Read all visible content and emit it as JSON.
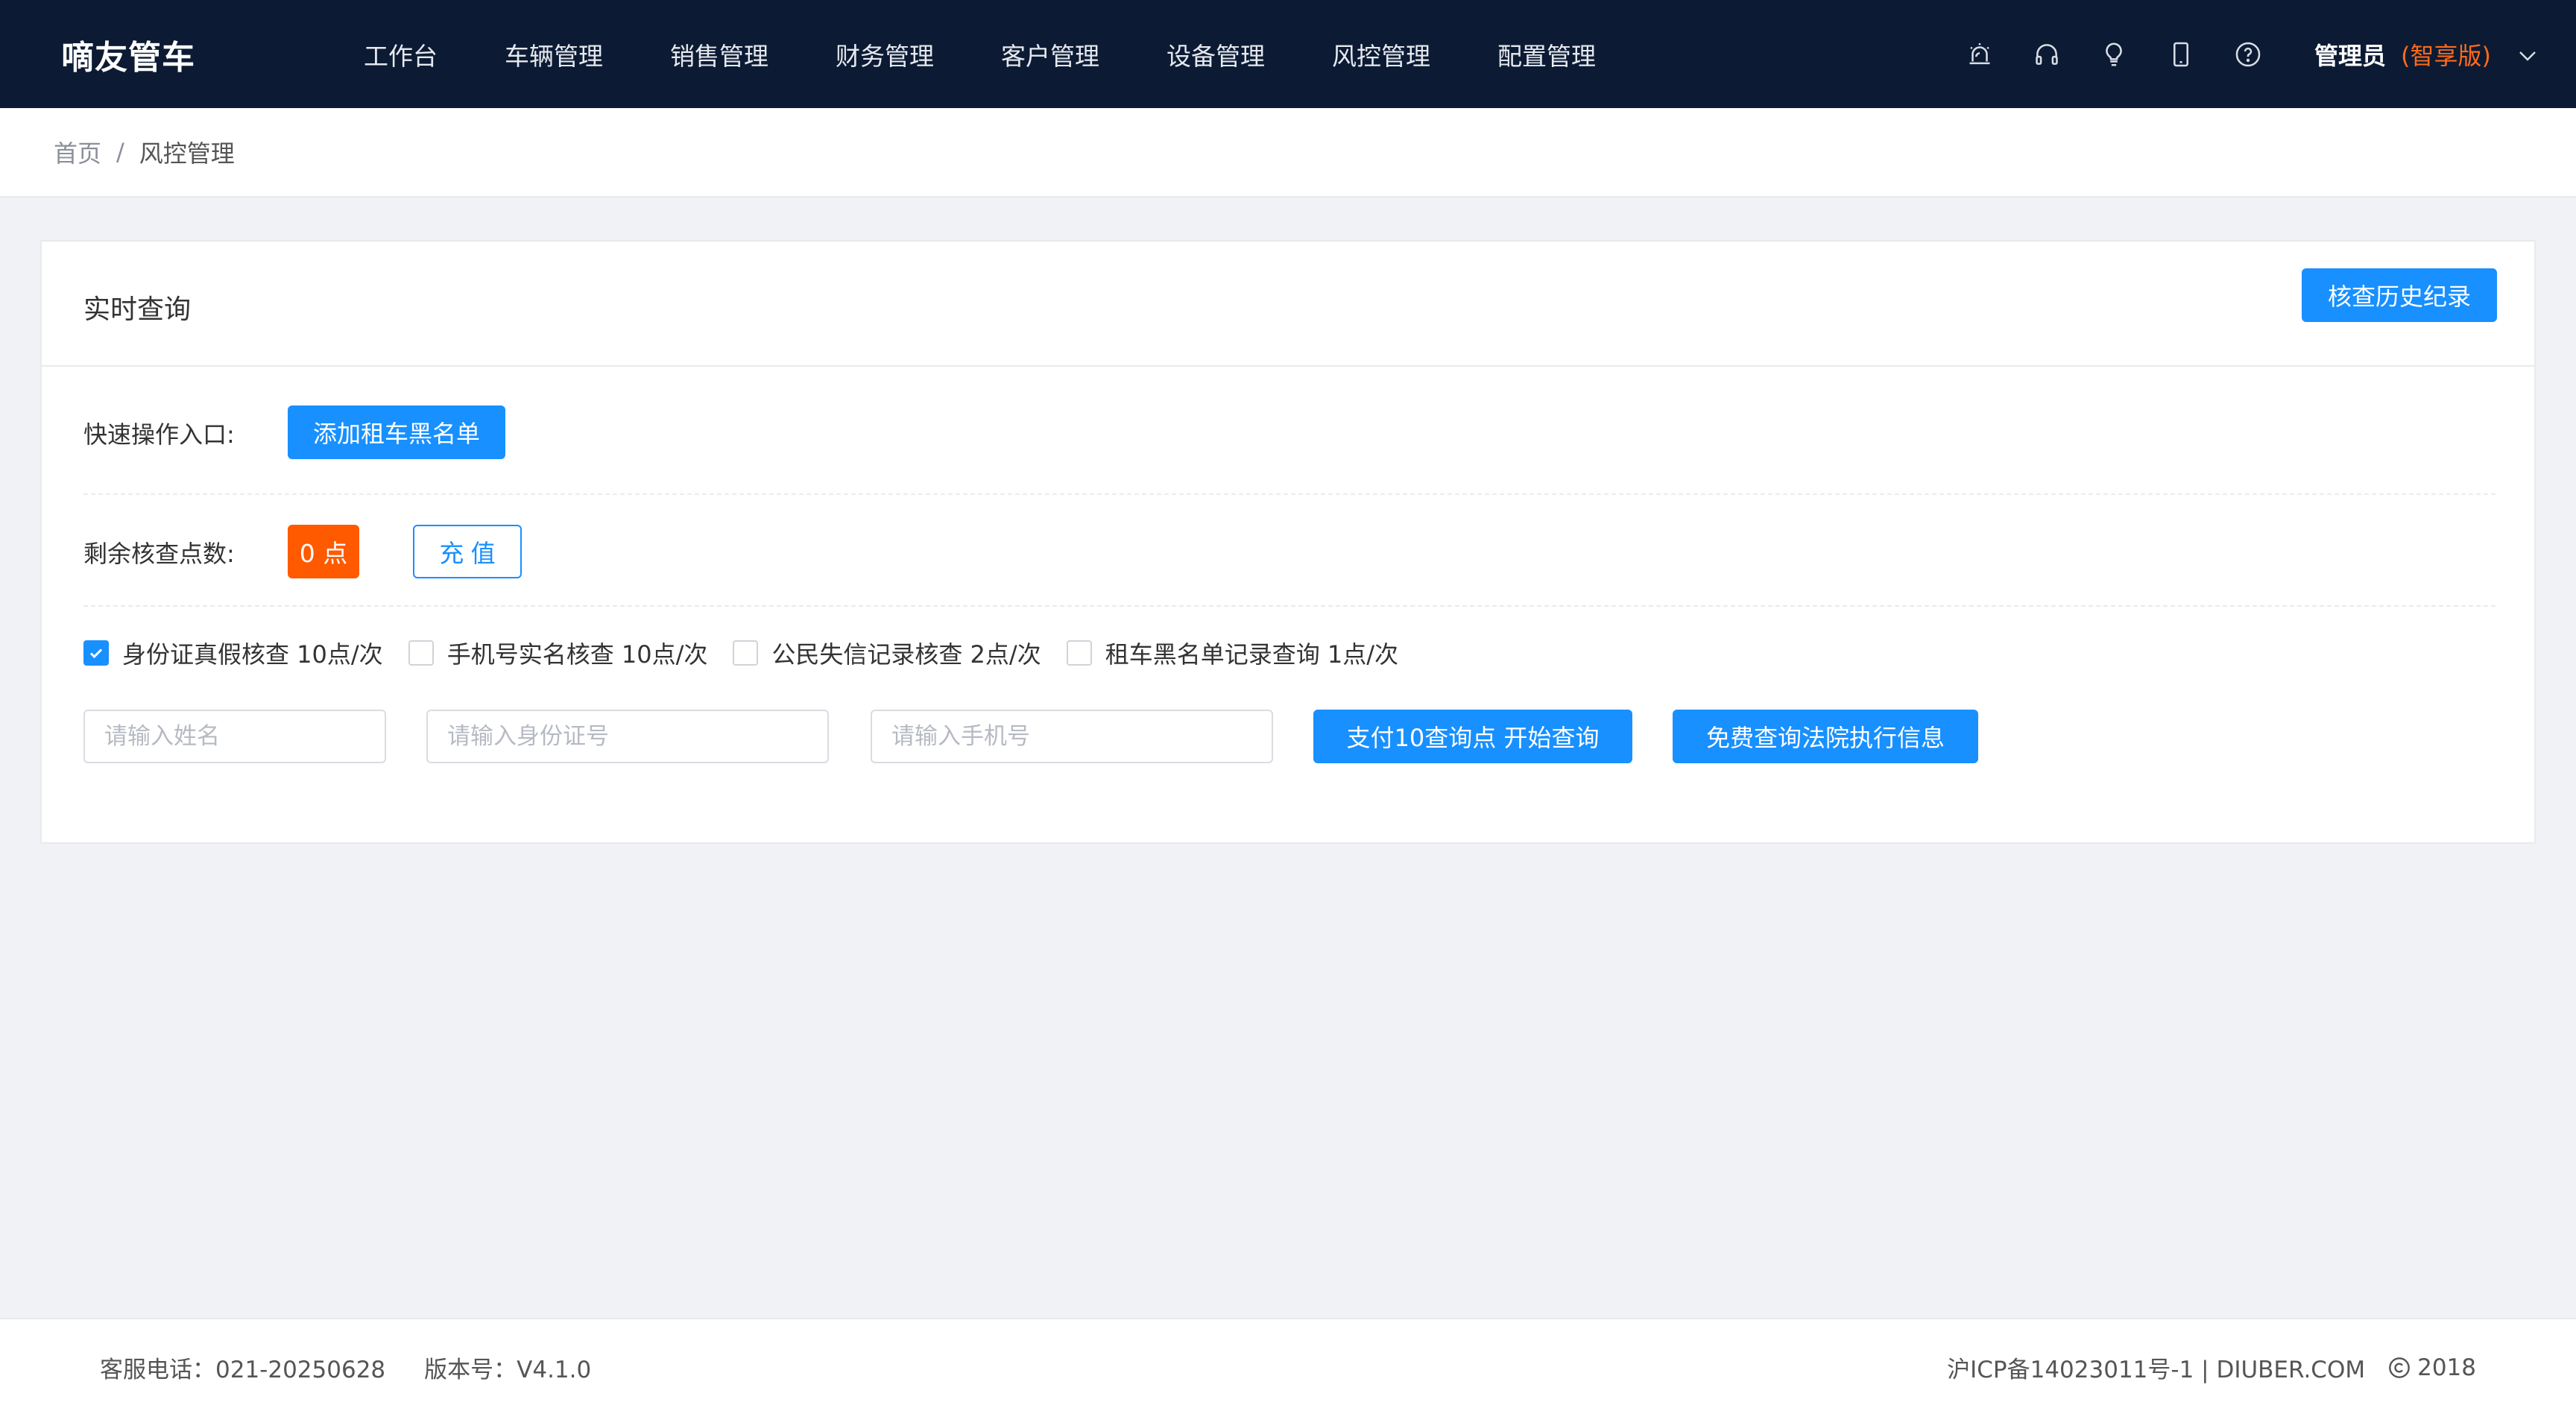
{
  "app": {
    "logo": "嘀友管车"
  },
  "nav": {
    "items": [
      {
        "label": "工作台"
      },
      {
        "label": "车辆管理"
      },
      {
        "label": "销售管理"
      },
      {
        "label": "财务管理"
      },
      {
        "label": "客户管理"
      },
      {
        "label": "设备管理"
      },
      {
        "label": "风控管理"
      },
      {
        "label": "配置管理"
      }
    ]
  },
  "toolbar": {
    "icons": [
      "alarm-icon",
      "headset-icon",
      "lightbulb-icon",
      "mobile-icon",
      "help-icon"
    ],
    "user_name": "管理员",
    "edition": "(智享版)"
  },
  "breadcrumb": {
    "home": "首页",
    "separator": "/",
    "current": "风控管理"
  },
  "card": {
    "title": "实时查询",
    "history_button": "核查历史纪录",
    "quick_label": "快速操作入口:",
    "add_blacklist_button": "添加租车黑名单",
    "points_label": "剩余核查点数:",
    "points_value": "0 点",
    "recharge_button": "充 值",
    "checks": [
      {
        "label": "身份证真假核查 10点/次",
        "checked": true
      },
      {
        "label": "手机号实名核查 10点/次",
        "checked": false
      },
      {
        "label": "公民失信记录核查 2点/次",
        "checked": false
      },
      {
        "label": "租车黑名单记录查询 1点/次",
        "checked": false
      }
    ],
    "name_placeholder": "请输入姓名",
    "id_placeholder": "请输入身份证号",
    "phone_placeholder": "请输入手机号",
    "pay_button": "支付10查询点 开始查询",
    "court_button": "免费查询法院执行信息"
  },
  "footer": {
    "service_phone": "客服电话：021-20250628",
    "version": "版本号：V4.1.0",
    "icp": "沪ICP备14023011号-1 | DIUBER.COM",
    "year": "2018"
  },
  "colors": {
    "topbar": "#0c1b33",
    "primary": "#1890ff",
    "points_badge": "#ff5a00",
    "edition": "#ff6a1a",
    "page_bg": "#f0f2f5"
  }
}
